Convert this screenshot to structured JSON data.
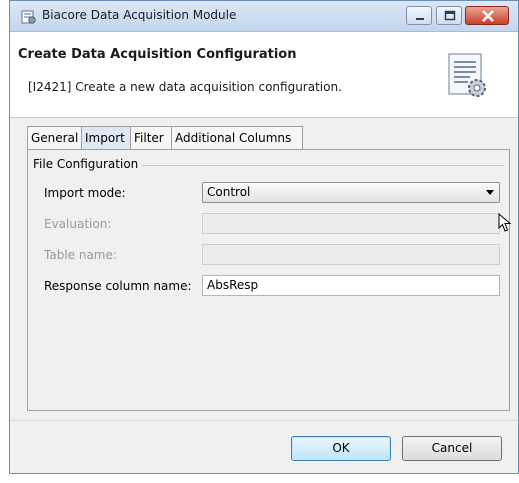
{
  "window": {
    "title": "Biacore Data Acquisition Module"
  },
  "header": {
    "title": "Create Data Acquisition Configuration",
    "message": "[I2421] Create a new data acquisition configuration."
  },
  "tabs": [
    {
      "label": "General",
      "active": false
    },
    {
      "label": "Import",
      "active": true
    },
    {
      "label": "Filter",
      "active": false
    },
    {
      "label": "Additional Columns",
      "active": false
    }
  ],
  "group": {
    "label": "File Configuration"
  },
  "form": {
    "import_mode": {
      "label": "Import mode:",
      "value": "Control"
    },
    "evaluation": {
      "label": "Evaluation:",
      "value": "",
      "enabled": false
    },
    "table_name": {
      "label": "Table name:",
      "value": "",
      "enabled": false
    },
    "response_column": {
      "label": "Response column name:",
      "value": "AbsResp"
    }
  },
  "buttons": {
    "ok": "OK",
    "cancel": "Cancel"
  },
  "colors": {
    "titlebar": "#c3d6ee",
    "close": "#c8412b",
    "ok_border": "#3c7fb1"
  }
}
